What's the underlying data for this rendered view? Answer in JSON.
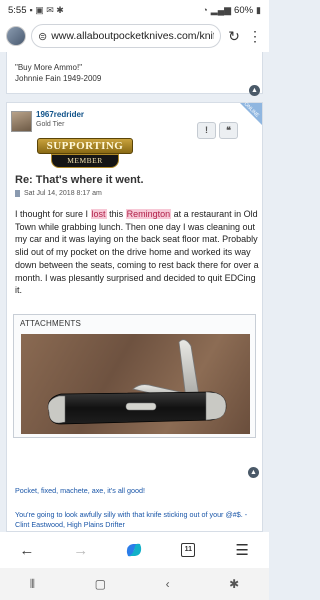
{
  "status_bar": {
    "time": "5:55",
    "battery": "60%"
  },
  "browser": {
    "url": "www.allaboutpocketknives.com/knife"
  },
  "prev_signature": {
    "quote": "\"Buy More Ammo!\"",
    "author": "Johnnie Fain 1949-2009"
  },
  "post": {
    "username": "1967redrider",
    "rank": "Gold Tier",
    "online_label": "ONLINE",
    "report_label": "!",
    "quote_label": "❝",
    "badge_top": "SUPPORTING",
    "badge_bottom": "MEMBER",
    "title": "Re: That's where it went.",
    "date": "Sat Jul 14, 2018 8:17 am",
    "body_1": "I thought for sure I ",
    "body_hl1": "lost",
    "body_2": " this ",
    "body_hl2": "Remington",
    "body_3": " at a restaurant in Old Town while grabbing lunch. Then one day I was cleaning out my car and it was laying on the back seat floor mat. Probably slid out of my pocket on the drive home and worked its way down between the seats, coming to rest back there for over a month. I was plesantly surprised and decided to quit EDCing it.",
    "attachments_label": "ATTACHMENTS",
    "signature_1": "Pocket, fixed, machete, axe, it's all good!",
    "signature_2": "You're going to look awfully silly with that knife sticking out of your @#$. - Clint Eastwood, High Plains Drifter"
  },
  "nav": {
    "tab_count": "11"
  },
  "colors": {
    "link": "#1a56a8",
    "username": "#105289",
    "highlight_bg": "#f7c8d6",
    "highlight_text": "#b0224a"
  }
}
